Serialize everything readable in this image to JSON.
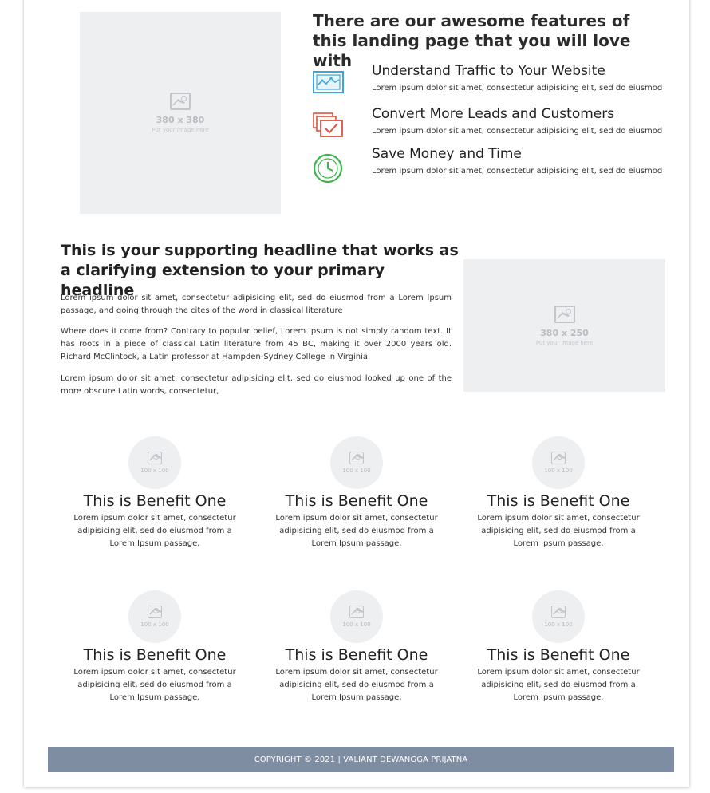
{
  "features": {
    "heading": "There are our awesome features of this landing page that you will love with",
    "image_placeholder": {
      "size": "380 x 380",
      "hint": "Put your image here"
    },
    "items": [
      {
        "title": "Understand Traffic to Your Website",
        "text": "Lorem ipsum dolor sit amet, consectetur adipisicing elit, sed do eiusmod",
        "icon": "traffic-chart-icon",
        "color": "#3aa6dd"
      },
      {
        "title": "Convert More Leads and Customers",
        "text": "Lorem ipsum dolor sit amet, consectetur adipisicing elit, sed do eiusmod",
        "icon": "stacked-cards-check-icon",
        "color": "#e0513f"
      },
      {
        "title": "Save Money and Time",
        "text": "Lorem ipsum dolor sit amet, consectetur adipisicing elit, sed do eiusmod",
        "icon": "clock-icon",
        "color": "#3bb54a"
      }
    ]
  },
  "supporting": {
    "headline": "This is your supporting headline that works as a clarifying extension to your primary headline",
    "paragraphs": [
      "Lorem ipsum dolor sit amet, consectetur adipisicing elit, sed do eiusmod from a Lorem Ipsum passage, and going through the cites of the word in classical literature",
      "Where does it come from? Contrary to popular belief, Lorem Ipsum is not simply random text. It has roots in a piece of classical Latin literature from 45 BC, making it over 2000 years old. Richard McClintock, a Latin professor at Hampden-Sydney College in Virginia.",
      "Lorem ipsum dolor sit amet, consectetur adipisicing elit, sed do eiusmod looked up one of the more obscure Latin words, consectetur,"
    ],
    "image_placeholder": {
      "size": "380 x 250",
      "hint": "Put your image here"
    }
  },
  "benefits": [
    {
      "title": "This is Benefit One",
      "text": "Lorem ipsum dolor sit amet, consectetur adipisicing elit, sed do eiusmod from a Lorem Ipsum passage,",
      "image": "100 x 100"
    },
    {
      "title": "This is Benefit One",
      "text": "Lorem ipsum dolor sit amet, consectetur adipisicing elit, sed do eiusmod from a Lorem Ipsum passage,",
      "image": "100 x 100"
    },
    {
      "title": "This is Benefit One",
      "text": "Lorem ipsum dolor sit amet, consectetur adipisicing elit, sed do eiusmod from a Lorem Ipsum passage,",
      "image": "100 x 100"
    },
    {
      "title": "This is Benefit One",
      "text": "Lorem ipsum dolor sit amet, consectetur adipisicing elit, sed do eiusmod from a Lorem Ipsum passage,",
      "image": "100 x 100"
    },
    {
      "title": "This is Benefit One",
      "text": "Lorem ipsum dolor sit amet, consectetur adipisicing elit, sed do eiusmod from a Lorem Ipsum passage,",
      "image": "100 x 100"
    },
    {
      "title": "This is Benefit One",
      "text": "Lorem ipsum dolor sit amet, consectetur adipisicing elit, sed do eiusmod from a Lorem Ipsum passage,",
      "image": "100 x 100"
    }
  ],
  "footer": {
    "text": "COPYRIGHT © 2021 | VALIANT DEWANGGA PRIJATNA",
    "color": "#7f8da3"
  }
}
